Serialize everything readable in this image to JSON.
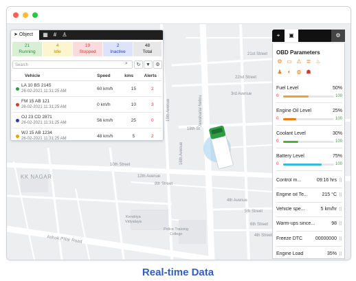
{
  "window": {
    "controls": {
      "close_color": "#ff5f57",
      "minimize_color": "#febc2e",
      "maximize_color": "#28c840"
    }
  },
  "map": {
    "streets": {
      "s1": "21st Street",
      "s2": "22nd Street",
      "s3": "3rd Avenue",
      "s4": "Jawaharlal Nehru",
      "s5": "18th St",
      "s6": "19th Avenue",
      "s7": "16th Avenue",
      "s8": "12th Avenue",
      "s9": "10th Street",
      "s10": "8th Street",
      "s11": "4th Avenue",
      "s12": "5th Street",
      "s13": "6th Street",
      "s14": "4th Street",
      "s15": "Ashok Pillar Road"
    },
    "locality": "KK NAGAR",
    "landmarks": {
      "l1": "Kendriya\nVidyalaya",
      "l2": "Police Training\nCollege"
    },
    "vehicle_marker": {
      "cab_color": "#2e9e46",
      "body_color": "#ffffff",
      "halo_color": "#6fb6e6"
    }
  },
  "object_panel": {
    "tab_label": "Object",
    "tab_icons": [
      "navigation-icon",
      "building-icon",
      "grid-icon",
      "user-icon"
    ],
    "stats": [
      {
        "count": "21",
        "label": "Running",
        "color": "#2e8b3a",
        "bg": "#d8efd6"
      },
      {
        "count": "4",
        "label": "Idle",
        "color": "#b38a00",
        "bg": "#fdf5cf"
      },
      {
        "count": "19",
        "label": "Stopped",
        "color": "#d23b35",
        "bg": "#fbdcdc"
      },
      {
        "count": "2",
        "label": "Inactive",
        "color": "#2a3db0",
        "bg": "#dde3fa"
      },
      {
        "count": "48",
        "label": "Total",
        "color": "#222222",
        "bg": "#e8e8e8"
      }
    ],
    "search_placeholder": "Search",
    "columns": {
      "vehicle": "Vehicle",
      "speed": "Speed",
      "kms": "kms",
      "alerts": "Alerts"
    },
    "rows": [
      {
        "id": "LA 10 BS 2145",
        "time": "26-02-2021 11:31:25 AM",
        "speed": "60 km/h",
        "kms": "15",
        "alerts": "2",
        "status_color": "#2e9e46"
      },
      {
        "id": "FM 15 AB 121",
        "time": "26-02-2021 11:31:25 AM",
        "speed": "0 km/h",
        "kms": "10",
        "alerts": "3",
        "status_color": "#d23b35"
      },
      {
        "id": "OJ 23 CD 2871",
        "time": "26-02-2021 11:31:25 AM",
        "speed": "56 km/h",
        "kms": "25",
        "alerts": "0",
        "status_color": "#2a3db0"
      },
      {
        "id": "WJ 15 AB 1234",
        "time": "26-02-2021 11:31:25 AM",
        "speed": "48 km/h",
        "kms": "5",
        "alerts": "2",
        "status_color": "#e0a800"
      }
    ]
  },
  "obd_panel": {
    "top_icons": [
      "map-pin-icon",
      "vehicle-icon",
      "gear-icon"
    ],
    "title": "OBD Parameters",
    "warning_icons": [
      "check-engine-icon",
      "battery-icon",
      "warning-triangle-icon",
      "headlight-icon",
      "coolant-temp-icon",
      "seatbelt-icon",
      "fog-light-icon",
      "oil-pressure-icon",
      "oil-level-icon"
    ],
    "gauges": [
      {
        "label": "Fuel Level",
        "percent": "50%",
        "value": 0.5,
        "min": "0",
        "max": "100",
        "color": "#f0a030"
      },
      {
        "label": "Engine Oil Level",
        "percent": "25%",
        "value": 0.25,
        "min": "0",
        "max": "100",
        "color": "#f07b16"
      },
      {
        "label": "Coolant Level",
        "percent": "30%",
        "value": 0.3,
        "min": "0",
        "max": "100",
        "color": "#5aac2e"
      },
      {
        "label": "Battery Level",
        "percent": "75%",
        "value": 0.75,
        "min": "0",
        "max": "100",
        "color": "#38b9d9"
      }
    ],
    "params": [
      {
        "label": "Control m...",
        "value": "09:16 hrs"
      },
      {
        "label": "Engine oil Te...",
        "value": "215 °C"
      },
      {
        "label": "Vehicle spe...",
        "value": "5 km/hr"
      },
      {
        "label": "Warm-ups since...",
        "value": "98"
      },
      {
        "label": "Freeze DTC",
        "value": "00000000"
      },
      {
        "label": "Engine Load",
        "value": "35%"
      }
    ]
  },
  "caption": "Real-time Data"
}
